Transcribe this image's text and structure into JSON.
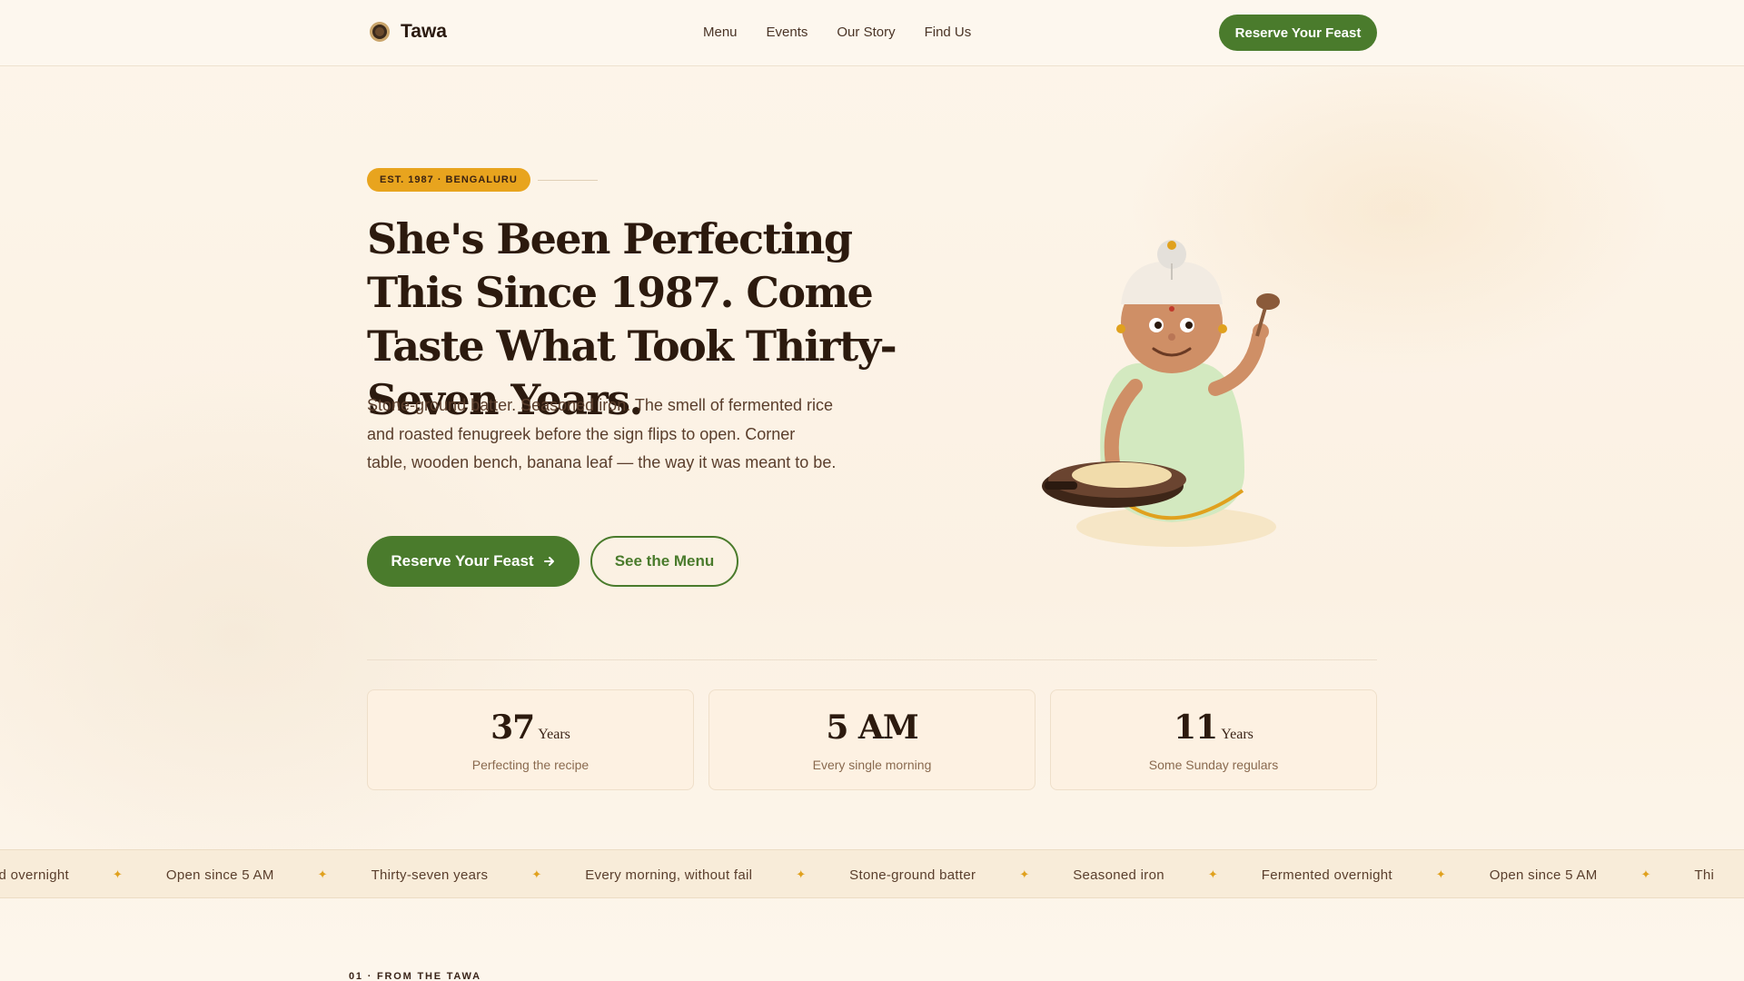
{
  "brand": {
    "name": "Tawa",
    "logo_icon": "tawa-logo-icon"
  },
  "nav": {
    "links": [
      "Menu",
      "Events",
      "Our Story",
      "Find Us"
    ],
    "cta_label": "Reserve Your Feast"
  },
  "hero": {
    "badge": "EST. 1987 · BENGALURU",
    "title": "She's Been Perfecting This Since 1987. Come Taste What Took Thirty-Seven Years.",
    "subtitle": "Stone-ground batter. Seasoned iron. The smell of fermented rice and roasted fenugreek before the sign flips to open. Corner table, wooden bench, banana leaf — the way it was meant to be.",
    "primary_cta": "Reserve Your Feast",
    "primary_cta_icon": "arrow-right-icon",
    "secondary_cta": "See the Menu"
  },
  "stats": [
    {
      "value": "37",
      "unit": "Years",
      "label": "Perfecting the recipe"
    },
    {
      "value": "5 AM",
      "unit": "",
      "label": "Every single morning"
    },
    {
      "value": "11",
      "unit": "Years",
      "label": "Some Sunday regulars"
    }
  ],
  "ticker": {
    "items": [
      "rmented overnight",
      "Open since 5 AM",
      "Thirty-seven years",
      "Every morning, without fail",
      "Stone-ground batter",
      "Seasoned iron",
      "Fermented overnight",
      "Open since 5 AM",
      "Thi"
    ],
    "separator": "✦"
  },
  "next_section": {
    "label": "01 · FROM THE TAWA"
  },
  "colors": {
    "accent_green": "#4a7b2c",
    "badge_amber": "#e8a41e",
    "heading_brown": "#2c1a0e",
    "background_cream": "#fdf6ec"
  }
}
